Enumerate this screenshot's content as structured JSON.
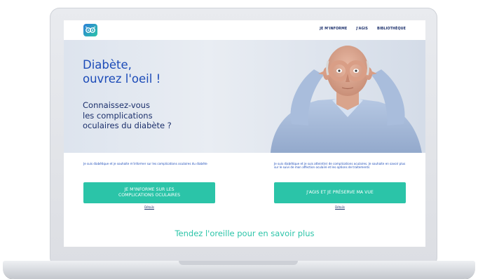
{
  "nav": {
    "links": [
      {
        "label": "JE M'INFORME"
      },
      {
        "label": "J'AGIS"
      },
      {
        "label": "BIBLIOTHÈQUE"
      }
    ]
  },
  "hero": {
    "title_line1": "Diabète,",
    "title_line2": "ouvrez l'oeil !",
    "subtitle_line1": "Connaissez-vous",
    "subtitle_line2": "les complications",
    "subtitle_line3": "oculaires du diabète ?"
  },
  "columns": [
    {
      "text": "Je suis diabétique et je souhaite m'informer sur les complications oculaires du diabète",
      "cta": "JE M'INFORME SUR LES\nCOMPLICATIONS OCULAIRES",
      "details": "Détails"
    },
    {
      "text": "Je suis diabétique et je suis atteint(e) de complications oculaires. Je souhaite en savoir plus sur le suivi de mon affection oculaire et les options de traitements",
      "cta": "J'AGIS ET JE PRÉSERVE MA VUE",
      "details": "Détails"
    }
  ],
  "banner": {
    "text": "Tendez l'oreille pour en savoir plus"
  },
  "colors": {
    "brand_blue": "#1c4bb8",
    "navy": "#1b2f6b",
    "accent_teal": "#2bc4a8"
  }
}
